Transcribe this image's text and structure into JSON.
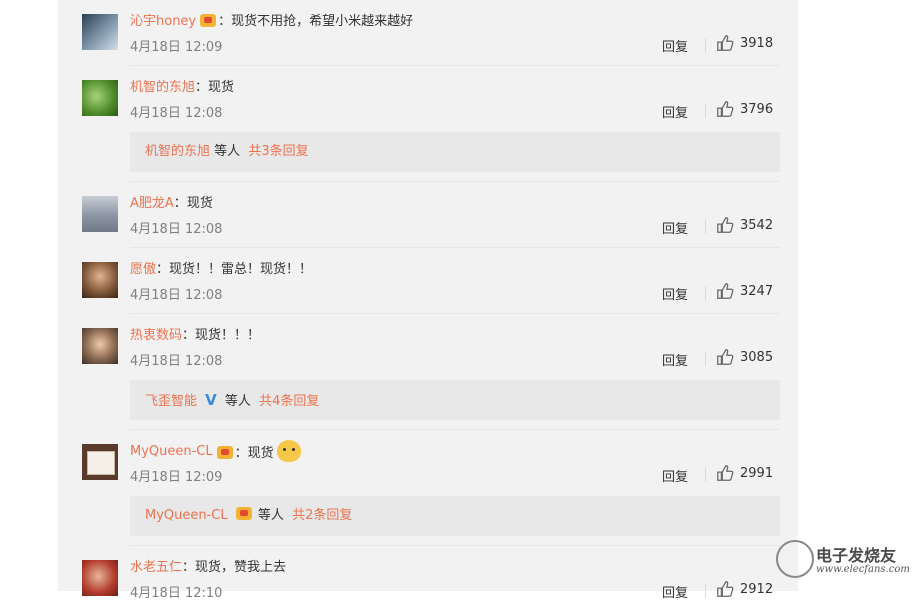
{
  "comments": [
    {
      "name": "沁宇honey",
      "has_badge": true,
      "text": "现货不用抢，希望小米越来越好",
      "time": "4月18日 12:09",
      "reply": "回复",
      "likes": "3918"
    },
    {
      "name": "机智的东旭",
      "text": "现货",
      "time": "4月18日 12:08",
      "reply": "回复",
      "likes": "3796",
      "sub": {
        "name": "机智的东旭",
        "mid": "等人",
        "count": "共3条回复"
      }
    },
    {
      "name": "A肥龙A",
      "text": "现货",
      "time": "4月18日 12:08",
      "reply": "回复",
      "likes": "3542"
    },
    {
      "name": "愿傲",
      "text": "现货！！雷总！现货！！",
      "time": "4月18日 12:08",
      "reply": "回复",
      "likes": "3247"
    },
    {
      "name": "热衷数码",
      "text": "现货！！！",
      "time": "4月18日 12:08",
      "reply": "回复",
      "likes": "3085",
      "sub": {
        "name": "飞歪智能",
        "verified": "V",
        "mid": "等人",
        "count": "共4条回复"
      }
    },
    {
      "name": "MyQueen-CL",
      "has_badge": true,
      "text": "现货",
      "emoji": "cat-emoji",
      "time": "4月18日 12:09",
      "reply": "回复",
      "likes": "2991",
      "sub": {
        "name": "MyQueen-CL",
        "mid": "等人",
        "count": "共2条回复"
      }
    },
    {
      "name": "水老五仁",
      "text": "现货，赞我上去",
      "time": "4月18日 12:10",
      "reply": "回复",
      "likes": "2912"
    }
  ],
  "colon": "：",
  "watermark": {
    "title": "电子发烧友",
    "url": "www.elecfans.com"
  },
  "colors": {
    "name": "#eb7350",
    "panel": "#f2f2f2",
    "sub_bg": "#e8e8e8",
    "verified": "#3b8bdc"
  }
}
